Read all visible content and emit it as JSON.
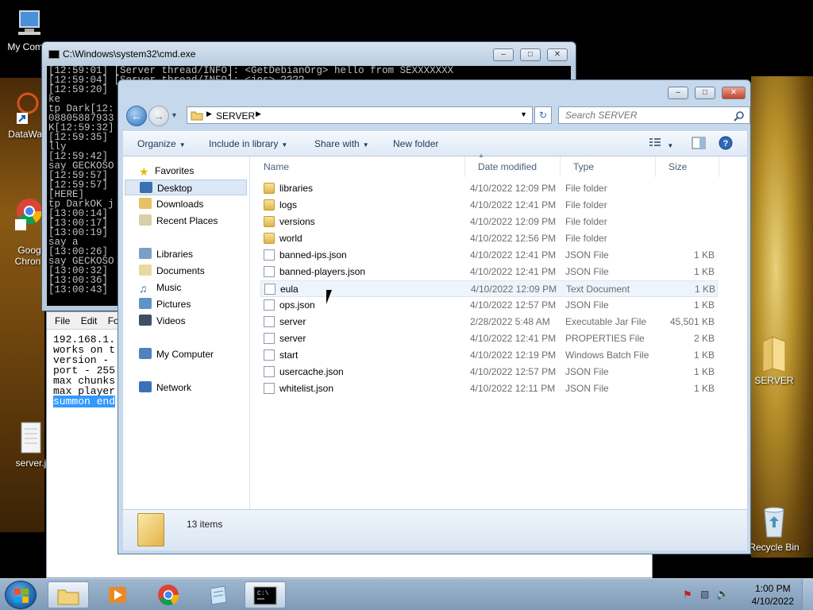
{
  "desktop": {
    "icons": [
      {
        "label": "My Comp"
      },
      {
        "label": "DataWag"
      },
      {
        "label": "Googl\nChron"
      },
      {
        "label": "server.j"
      },
      {
        "label": "SERVER"
      },
      {
        "label": "Recycle Bin"
      }
    ]
  },
  "cmd": {
    "title": "C:\\Windows\\system32\\cmd.exe",
    "lines": [
      "[12:59:01] [Server thread/INFO]: <GetDebianOrg> hello from SEXXXXXXX",
      "[12:59:04] [Server thread/INFO]: <jos> ????",
      "[12:59:20]",
      "ke",
      "tp Dark[12:",
      "08805887933",
      "K[12:59:32]",
      "[12:59:35]",
      "lly",
      "[12:59:42]",
      "say GECKOSO",
      "[12:59:57]",
      "[12:59:57]",
      "[HERE]",
      "tp DarkOK j",
      "[13:00:14]",
      "[13:00:17]",
      "[13:00:19]",
      "say a",
      "[13:00:26]",
      "say GECKOSO",
      "[13:00:32]",
      "[13:00:36]",
      "[13:00:43]"
    ]
  },
  "notepad": {
    "menu": [
      "File",
      "Edit",
      "Fo"
    ],
    "lines": [
      "192.168.1.",
      "works on t",
      "version -",
      "port - 255",
      "max chunks",
      "max player"
    ],
    "selected_line": "summon end"
  },
  "explorer": {
    "breadcrumb": "SERVER",
    "search_placeholder": "Search SERVER",
    "toolbar": {
      "organize": "Organize",
      "include_in_library": "Include in library",
      "share_with": "Share with",
      "new_folder": "New folder"
    },
    "nav": {
      "favorites": "Favorites",
      "desktop": "Desktop",
      "downloads": "Downloads",
      "recent_places": "Recent Places",
      "libraries": "Libraries",
      "documents": "Documents",
      "music": "Music",
      "pictures": "Pictures",
      "videos": "Videos",
      "my_computer": "My Computer",
      "network": "Network"
    },
    "columns": {
      "name": "Name",
      "date": "Date modified",
      "type": "Type",
      "size": "Size"
    },
    "files": [
      {
        "name": "libraries",
        "date": "4/10/2022 12:09 PM",
        "type": "File folder",
        "size": "",
        "icon": "folder"
      },
      {
        "name": "logs",
        "date": "4/10/2022 12:41 PM",
        "type": "File folder",
        "size": "",
        "icon": "folder"
      },
      {
        "name": "versions",
        "date": "4/10/2022 12:09 PM",
        "type": "File folder",
        "size": "",
        "icon": "folder"
      },
      {
        "name": "world",
        "date": "4/10/2022 12:56 PM",
        "type": "File folder",
        "size": "",
        "icon": "folder"
      },
      {
        "name": "banned-ips.json",
        "date": "4/10/2022 12:41 PM",
        "type": "JSON File",
        "size": "1 KB",
        "icon": "doc"
      },
      {
        "name": "banned-players.json",
        "date": "4/10/2022 12:41 PM",
        "type": "JSON File",
        "size": "1 KB",
        "icon": "doc"
      },
      {
        "name": "eula",
        "date": "4/10/2022 12:09 PM",
        "type": "Text Document",
        "size": "1 KB",
        "icon": "doc"
      },
      {
        "name": "ops.json",
        "date": "4/10/2022 12:57 PM",
        "type": "JSON File",
        "size": "1 KB",
        "icon": "doc"
      },
      {
        "name": "server",
        "date": "2/28/2022 5:48 AM",
        "type": "Executable Jar File",
        "size": "45,501 KB",
        "icon": "doc"
      },
      {
        "name": "server",
        "date": "4/10/2022 12:41 PM",
        "type": "PROPERTIES File",
        "size": "2 KB",
        "icon": "doc"
      },
      {
        "name": "start",
        "date": "4/10/2022 12:19 PM",
        "type": "Windows Batch File",
        "size": "1 KB",
        "icon": "doc"
      },
      {
        "name": "usercache.json",
        "date": "4/10/2022 12:57 PM",
        "type": "JSON File",
        "size": "1 KB",
        "icon": "doc"
      },
      {
        "name": "whitelist.json",
        "date": "4/10/2022 12:11 PM",
        "type": "JSON File",
        "size": "1 KB",
        "icon": "doc"
      }
    ],
    "item_count": "13 items"
  },
  "taskbar": {
    "time": "1:00 PM",
    "date": "4/10/2022"
  }
}
